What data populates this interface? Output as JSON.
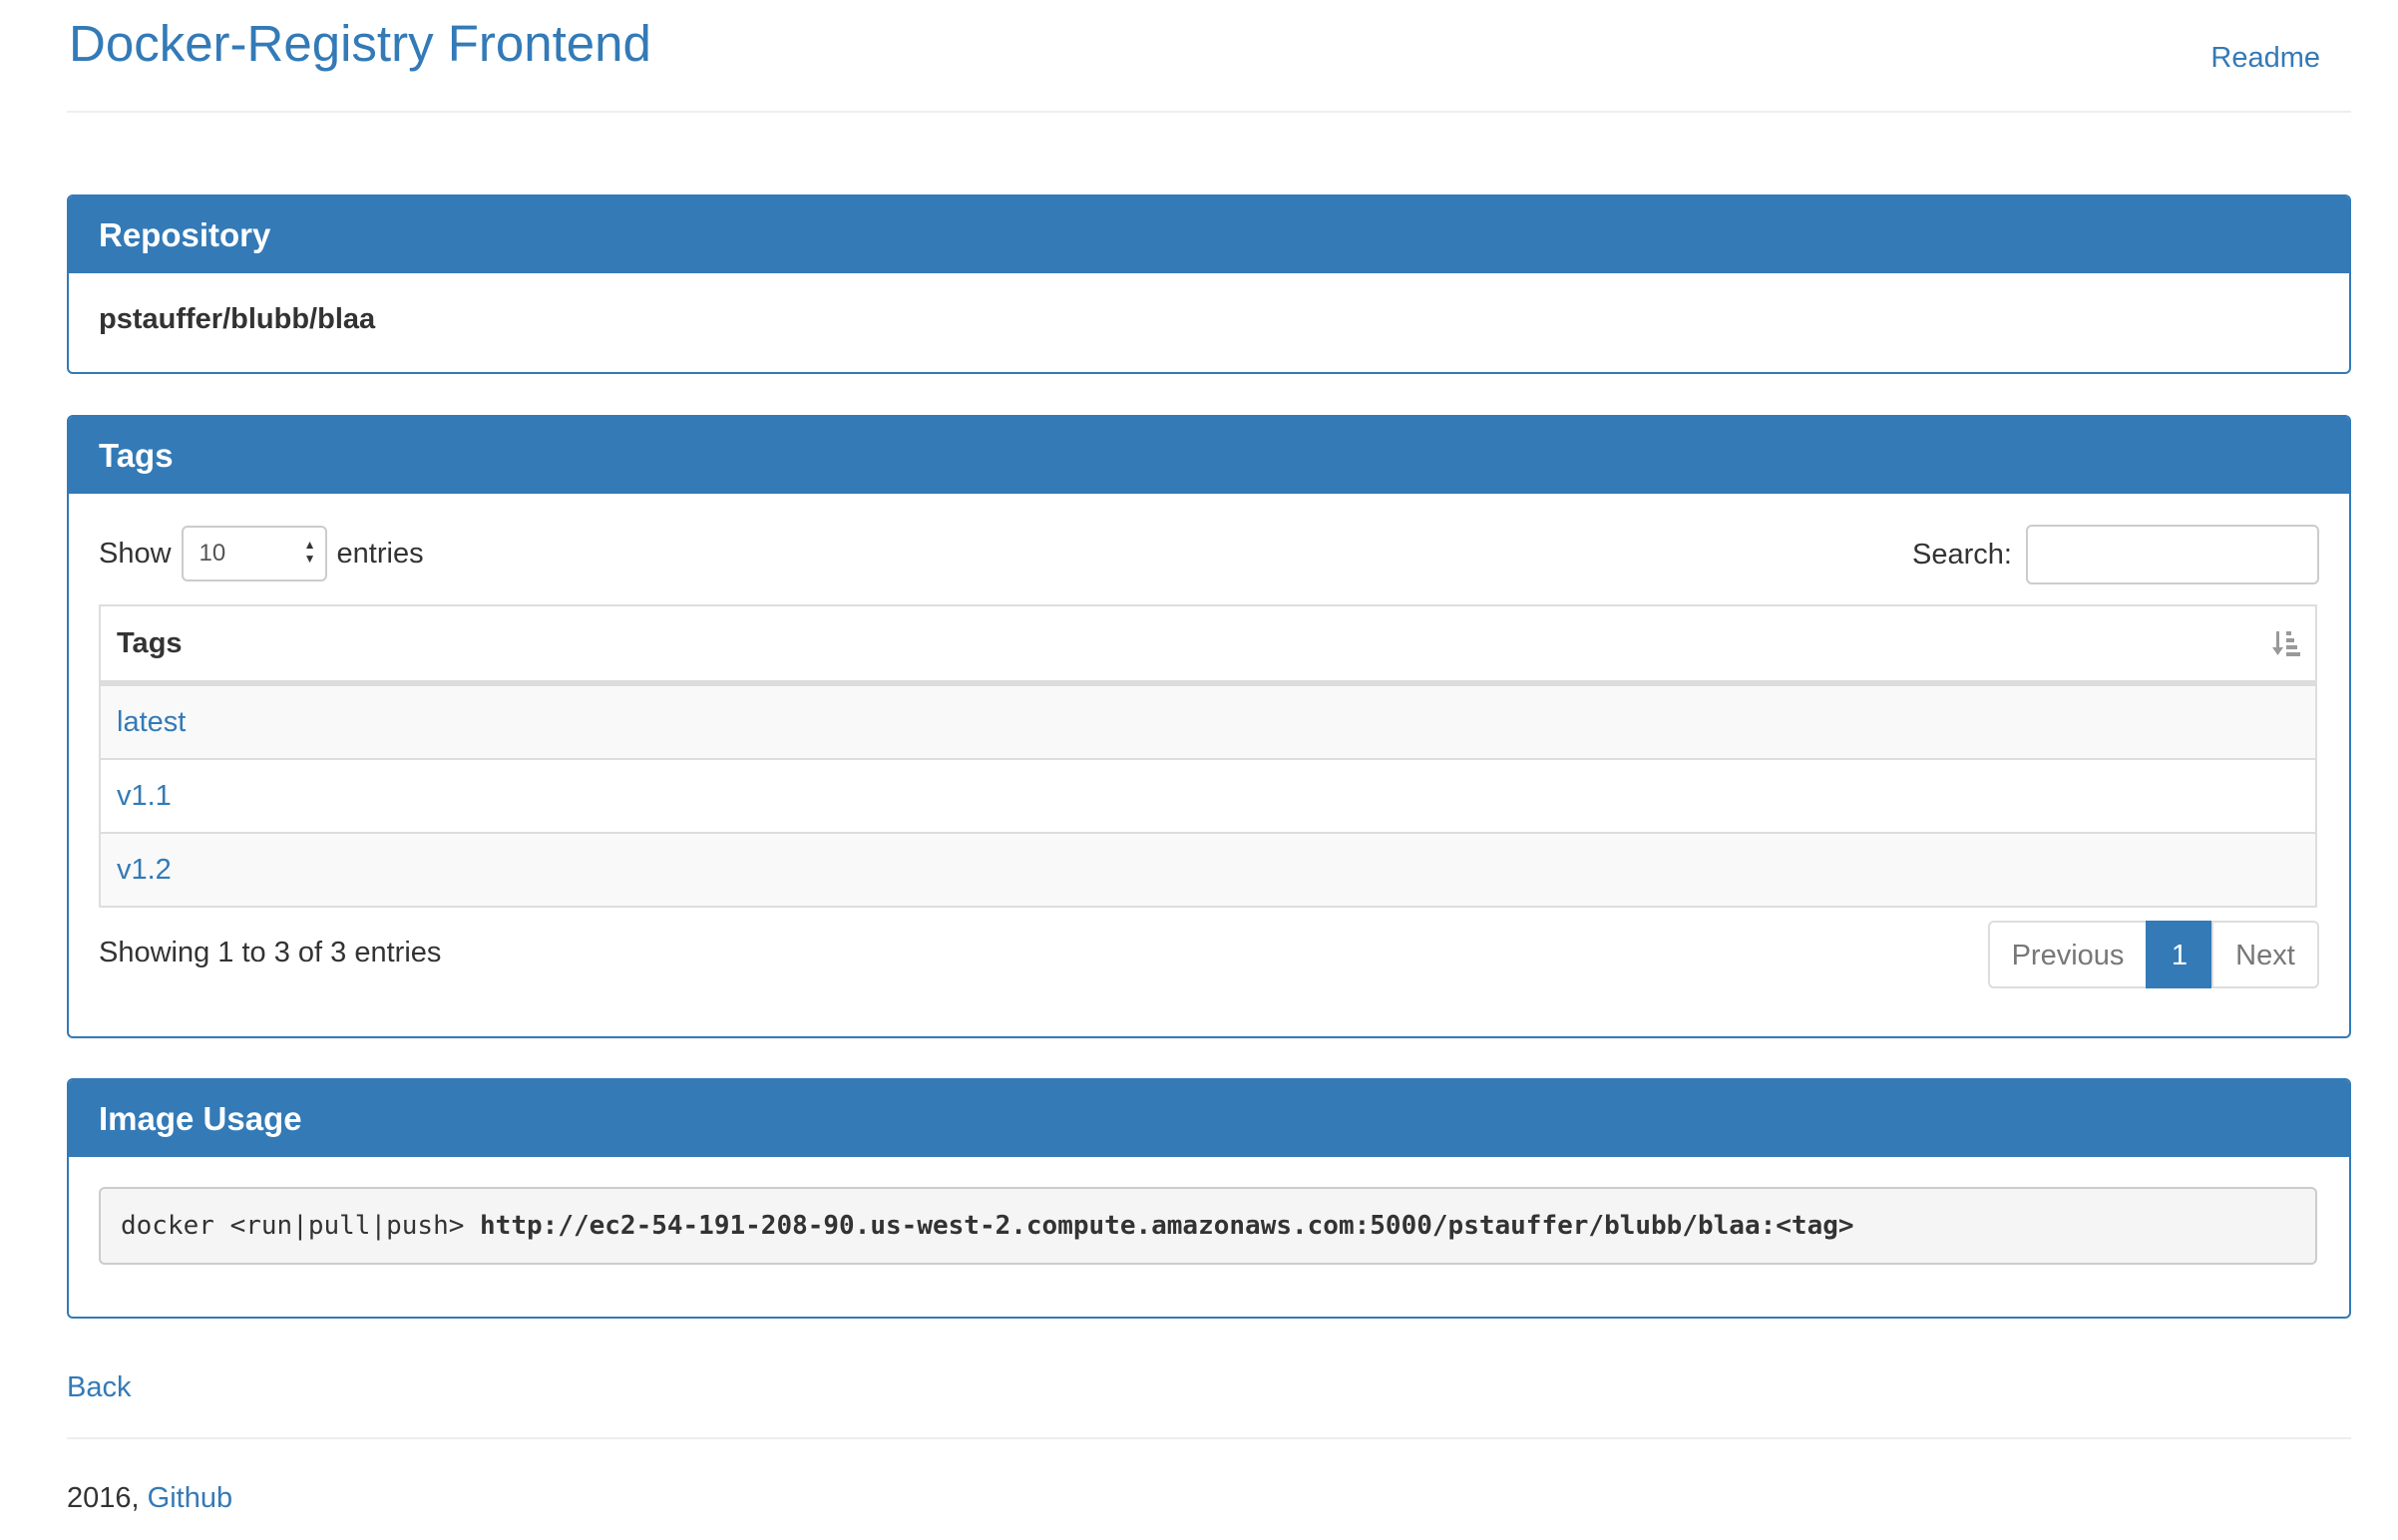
{
  "header": {
    "brand": "Docker-Registry Frontend",
    "readme_link": "Readme"
  },
  "repository_panel": {
    "title": "Repository",
    "name": "pstauffer/blubb/blaa"
  },
  "tags_panel": {
    "title": "Tags",
    "length": {
      "show_label": "Show",
      "value": "10",
      "entries_label": "entries"
    },
    "search": {
      "label": "Search:",
      "value": "",
      "placeholder": ""
    },
    "table": {
      "column_header": "Tags",
      "sort_icon": "sort-alpha-icon",
      "rows": [
        "latest",
        "v1.1",
        "v1.2"
      ]
    },
    "info": "Showing 1 to 3 of 3 entries",
    "pagination": {
      "previous": "Previous",
      "current": "1",
      "next": "Next"
    }
  },
  "usage_panel": {
    "title": "Image Usage",
    "command_prefix": "docker <run|pull|push> ",
    "command_target": "http://ec2-54-191-208-90.us-west-2.compute.amazonaws.com:5000/pstauffer/blubb/blaa:<tag>"
  },
  "back_link": "Back",
  "footer": {
    "year": "2016, ",
    "github_link": "Github"
  },
  "colors": {
    "primary": "#337ab7",
    "border": "#dddddd",
    "stripe": "#f9f9f9",
    "code_bg": "#f5f5f5"
  }
}
